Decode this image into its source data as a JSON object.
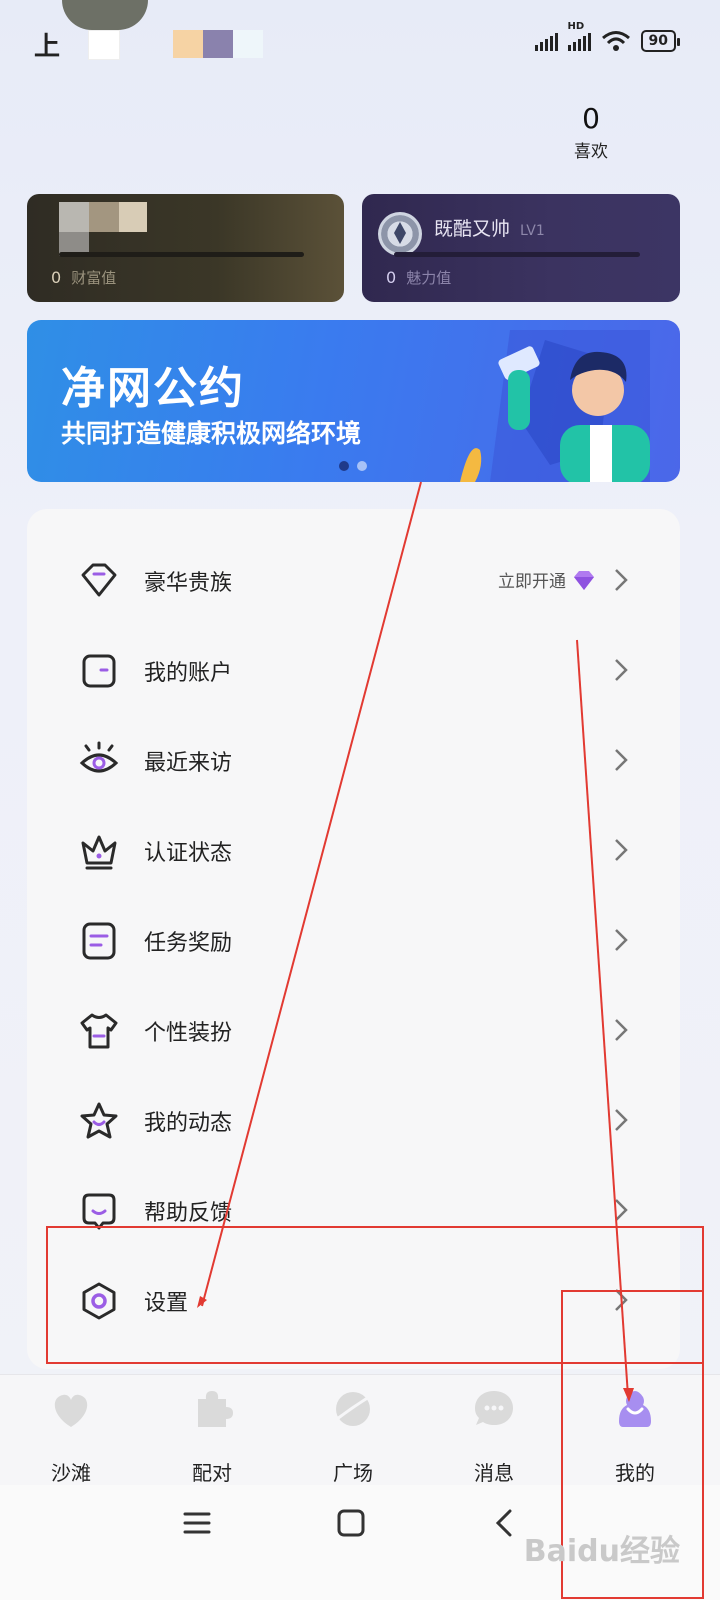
{
  "status_bar": {
    "carrier": "上",
    "network_label": "HD",
    "battery": "90"
  },
  "profile": {
    "likes_count": "0",
    "likes_label": "喜欢"
  },
  "wealth_card": {
    "value": "0",
    "label": "财富值"
  },
  "charm_card": {
    "name": "既酷又帅",
    "level": "LV1",
    "value": "0",
    "label": "魅力值"
  },
  "banner": {
    "title": "净网公约",
    "subtitle": "共同打造健康积极网络环境",
    "slide_index": 1,
    "slide_count": 2
  },
  "menu": {
    "items": [
      {
        "label": "豪华贵族",
        "icon": "diamond-outline-icon",
        "extra": "立即开通",
        "extra_icon": "purple-diamond-icon"
      },
      {
        "label": "我的账户",
        "icon": "wallet-icon"
      },
      {
        "label": "最近来访",
        "icon": "eye-icon"
      },
      {
        "label": "认证状态",
        "icon": "crown-verify-icon"
      },
      {
        "label": "任务奖励",
        "icon": "task-list-icon"
      },
      {
        "label": "个性装扮",
        "icon": "tshirt-icon"
      },
      {
        "label": "我的动态",
        "icon": "star-icon"
      },
      {
        "label": "帮助反馈",
        "icon": "feedback-icon"
      },
      {
        "label": "设置",
        "icon": "settings-hexagon-icon"
      }
    ]
  },
  "bottom_nav": {
    "items": [
      {
        "label": "沙滩",
        "icon": "beach-heart-icon",
        "active": false
      },
      {
        "label": "配对",
        "icon": "puzzle-icon",
        "active": false
      },
      {
        "label": "广场",
        "icon": "planet-icon",
        "active": false
      },
      {
        "label": "消息",
        "icon": "chat-bubble-icon",
        "active": false
      },
      {
        "label": "我的",
        "icon": "profile-icon",
        "active": true
      }
    ]
  },
  "system_nav": {
    "icons": [
      "menu-icon",
      "home-icon",
      "back-icon"
    ]
  },
  "colors": {
    "accent_purple": "#9b5de5",
    "banner_blue": "#3a7bef",
    "annotation_red": "#e23a32"
  },
  "watermark": "Baidu经验"
}
